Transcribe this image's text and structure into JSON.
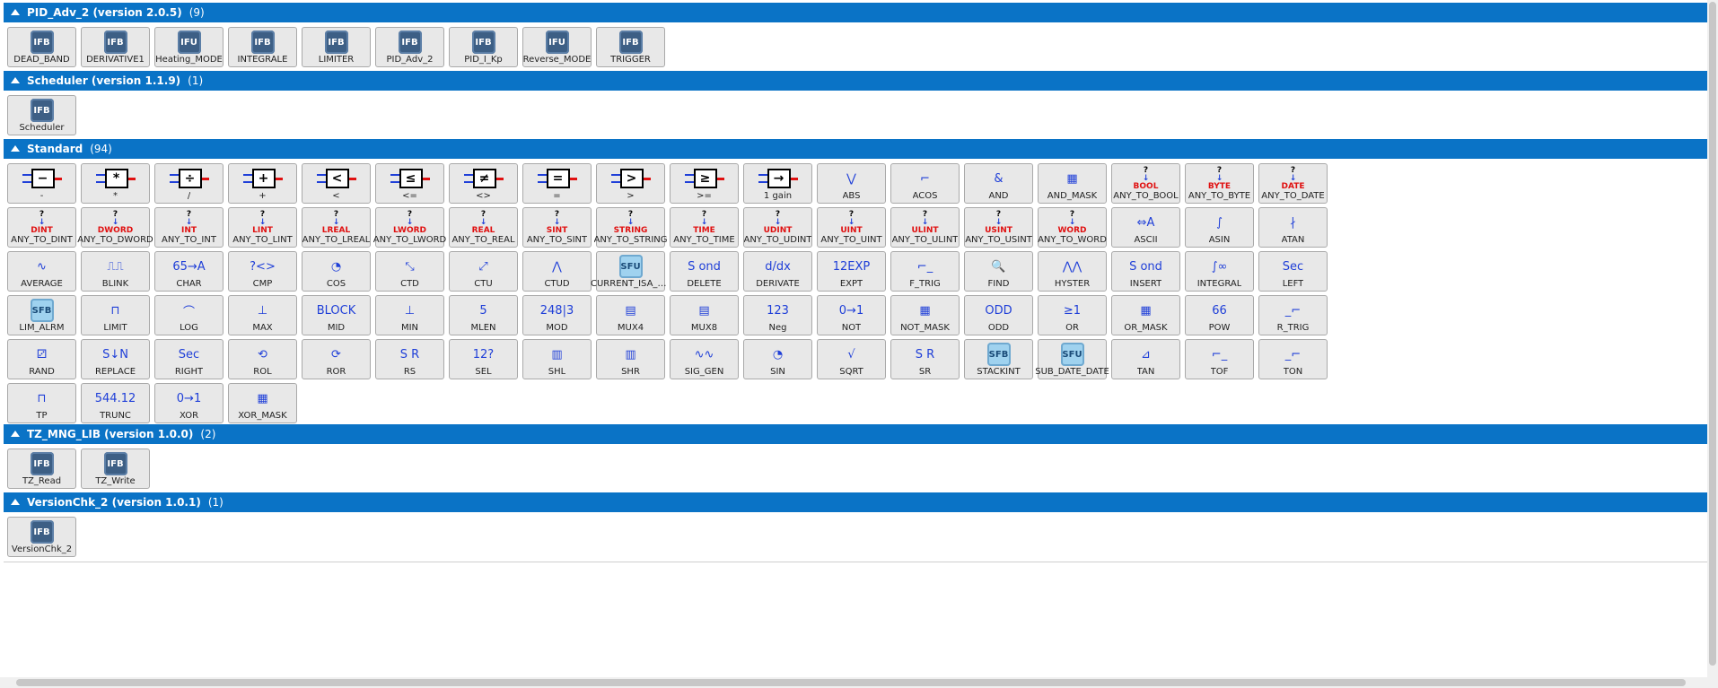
{
  "libraries": [
    {
      "name": "PID_Adv_2 (version 2.0.5)",
      "count": "(9)",
      "items": [
        {
          "label": "DEAD_BAND",
          "icon": "IFB"
        },
        {
          "label": "DERIVATIVE1",
          "icon": "IFB"
        },
        {
          "label": "Heating_MODE",
          "icon": "IFU"
        },
        {
          "label": "INTEGRALE",
          "icon": "IFB"
        },
        {
          "label": "LIMITER",
          "icon": "IFB"
        },
        {
          "label": "PID_Adv_2",
          "icon": "IFB"
        },
        {
          "label": "PID_I_Kp",
          "icon": "IFB"
        },
        {
          "label": "Reverse_MODE",
          "icon": "IFU"
        },
        {
          "label": "TRIGGER",
          "icon": "IFB"
        }
      ]
    },
    {
      "name": "Scheduler (version 1.1.9)",
      "count": "(1)",
      "items": [
        {
          "label": "Scheduler",
          "icon": "IFB"
        }
      ]
    },
    {
      "name": "Standard",
      "count": "(94)",
      "items": [
        {
          "label": "-",
          "icon": "op",
          "sym": "−"
        },
        {
          "label": "*",
          "icon": "op",
          "sym": "*"
        },
        {
          "label": "/",
          "icon": "op",
          "sym": "÷"
        },
        {
          "label": "+",
          "icon": "op",
          "sym": "+"
        },
        {
          "label": "<",
          "icon": "op",
          "sym": "<"
        },
        {
          "label": "<=",
          "icon": "op",
          "sym": "≤"
        },
        {
          "label": "<>",
          "icon": "op",
          "sym": "≠"
        },
        {
          "label": "=",
          "icon": "op",
          "sym": "="
        },
        {
          "label": ">",
          "icon": "op",
          "sym": ">"
        },
        {
          "label": ">=",
          "icon": "op",
          "sym": "≥"
        },
        {
          "label": "1 gain",
          "icon": "op",
          "sym": "→"
        },
        {
          "label": "ABS",
          "icon": "glyph",
          "sym": "⋁"
        },
        {
          "label": "ACOS",
          "icon": "glyph",
          "sym": "⌐"
        },
        {
          "label": "AND",
          "icon": "glyph",
          "sym": "&"
        },
        {
          "label": "AND_MASK",
          "icon": "glyph",
          "sym": "▦"
        },
        {
          "label": "ANY_TO_BOOL",
          "icon": "conv",
          "sym": "BOOL"
        },
        {
          "label": "ANY_TO_BYTE",
          "icon": "conv",
          "sym": "BYTE"
        },
        {
          "label": "ANY_TO_DATE",
          "icon": "conv",
          "sym": "DATE"
        },
        {
          "label": "ANY_TO_DINT",
          "icon": "conv",
          "sym": "DINT"
        },
        {
          "label": "ANY_TO_DWORD",
          "icon": "conv",
          "sym": "DWORD"
        },
        {
          "label": "ANY_TO_INT",
          "icon": "conv",
          "sym": "INT"
        },
        {
          "label": "ANY_TO_LINT",
          "icon": "conv",
          "sym": "LINT"
        },
        {
          "label": "ANY_TO_LREAL",
          "icon": "conv",
          "sym": "LREAL"
        },
        {
          "label": "ANY_TO_LWORD",
          "icon": "conv",
          "sym": "LWORD"
        },
        {
          "label": "ANY_TO_REAL",
          "icon": "conv",
          "sym": "REAL"
        },
        {
          "label": "ANY_TO_SINT",
          "icon": "conv",
          "sym": "SINT"
        },
        {
          "label": "ANY_TO_STRING",
          "icon": "conv",
          "sym": "STRING"
        },
        {
          "label": "ANY_TO_TIME",
          "icon": "conv",
          "sym": "TIME"
        },
        {
          "label": "ANY_TO_UDINT",
          "icon": "conv",
          "sym": "UDINT"
        },
        {
          "label": "ANY_TO_UINT",
          "icon": "conv",
          "sym": "UINT"
        },
        {
          "label": "ANY_TO_ULINT",
          "icon": "conv",
          "sym": "ULINT"
        },
        {
          "label": "ANY_TO_USINT",
          "icon": "conv",
          "sym": "USINT"
        },
        {
          "label": "ANY_TO_WORD",
          "icon": "conv",
          "sym": "WORD"
        },
        {
          "label": "ASCII",
          "icon": "glyph",
          "sym": "⇔A"
        },
        {
          "label": "ASIN",
          "icon": "glyph",
          "sym": "∫"
        },
        {
          "label": "ATAN",
          "icon": "glyph",
          "sym": "∤"
        },
        {
          "label": "AVERAGE",
          "icon": "glyph",
          "sym": "∿"
        },
        {
          "label": "BLINK",
          "icon": "glyph",
          "sym": "⎍⎍"
        },
        {
          "label": "CHAR",
          "icon": "glyph",
          "sym": "65→A"
        },
        {
          "label": "CMP",
          "icon": "glyph",
          "sym": "?<>"
        },
        {
          "label": "COS",
          "icon": "glyph",
          "sym": "◔"
        },
        {
          "label": "CTD",
          "icon": "glyph",
          "sym": "⤡"
        },
        {
          "label": "CTU",
          "icon": "glyph",
          "sym": "⤢"
        },
        {
          "label": "CTUD",
          "icon": "glyph",
          "sym": "⋀"
        },
        {
          "label": "CURRENT_ISA_DA...",
          "icon": "SFU"
        },
        {
          "label": "DELETE",
          "icon": "glyph",
          "sym": "S ond"
        },
        {
          "label": "DERIVATE",
          "icon": "glyph",
          "sym": "d/dx"
        },
        {
          "label": "EXPT",
          "icon": "glyph",
          "sym": "12EXP"
        },
        {
          "label": "F_TRIG",
          "icon": "glyph",
          "sym": "⌐_"
        },
        {
          "label": "FIND",
          "icon": "glyph",
          "sym": "🔍"
        },
        {
          "label": "HYSTER",
          "icon": "glyph",
          "sym": "⋀⋀"
        },
        {
          "label": "INSERT",
          "icon": "glyph",
          "sym": "S ond"
        },
        {
          "label": "INTEGRAL",
          "icon": "glyph",
          "sym": "∫∞"
        },
        {
          "label": "LEFT",
          "icon": "glyph",
          "sym": "Sec"
        },
        {
          "label": "LIM_ALRM",
          "icon": "SFB"
        },
        {
          "label": "LIMIT",
          "icon": "glyph",
          "sym": "⊓"
        },
        {
          "label": "LOG",
          "icon": "glyph",
          "sym": "⌒"
        },
        {
          "label": "MAX",
          "icon": "glyph",
          "sym": "⊥"
        },
        {
          "label": "MID",
          "icon": "glyph",
          "sym": "BLOCK"
        },
        {
          "label": "MIN",
          "icon": "glyph",
          "sym": "⊥"
        },
        {
          "label": "MLEN",
          "icon": "glyph",
          "sym": "5"
        },
        {
          "label": "MOD",
          "icon": "glyph",
          "sym": "248|3"
        },
        {
          "label": "MUX4",
          "icon": "glyph",
          "sym": "▤"
        },
        {
          "label": "MUX8",
          "icon": "glyph",
          "sym": "▤"
        },
        {
          "label": "Neg",
          "icon": "glyph",
          "sym": "123"
        },
        {
          "label": "NOT",
          "icon": "glyph",
          "sym": "0→1"
        },
        {
          "label": "NOT_MASK",
          "icon": "glyph",
          "sym": "▦"
        },
        {
          "label": "ODD",
          "icon": "glyph",
          "sym": "ODD"
        },
        {
          "label": "OR",
          "icon": "glyph",
          "sym": "≥1"
        },
        {
          "label": "OR_MASK",
          "icon": "glyph",
          "sym": "▦"
        },
        {
          "label": "POW",
          "icon": "glyph",
          "sym": "66"
        },
        {
          "label": "R_TRIG",
          "icon": "glyph",
          "sym": "_⌐"
        },
        {
          "label": "RAND",
          "icon": "glyph",
          "sym": "⚂"
        },
        {
          "label": "REPLACE",
          "icon": "glyph",
          "sym": "S↓N"
        },
        {
          "label": "RIGHT",
          "icon": "glyph",
          "sym": "Sec"
        },
        {
          "label": "ROL",
          "icon": "glyph",
          "sym": "⟲"
        },
        {
          "label": "ROR",
          "icon": "glyph",
          "sym": "⟳"
        },
        {
          "label": "RS",
          "icon": "glyph",
          "sym": "S R"
        },
        {
          "label": "SEL",
          "icon": "glyph",
          "sym": "12?"
        },
        {
          "label": "SHL",
          "icon": "glyph",
          "sym": "▥"
        },
        {
          "label": "SHR",
          "icon": "glyph",
          "sym": "▥"
        },
        {
          "label": "SIG_GEN",
          "icon": "glyph",
          "sym": "∿∿"
        },
        {
          "label": "SIN",
          "icon": "glyph",
          "sym": "◔"
        },
        {
          "label": "SQRT",
          "icon": "glyph",
          "sym": "√"
        },
        {
          "label": "SR",
          "icon": "glyph",
          "sym": "S R"
        },
        {
          "label": "STACKINT",
          "icon": "SFB"
        },
        {
          "label": "SUB_DATE_DATE",
          "icon": "SFU"
        },
        {
          "label": "TAN",
          "icon": "glyph",
          "sym": "⊿"
        },
        {
          "label": "TOF",
          "icon": "glyph",
          "sym": "⌐_"
        },
        {
          "label": "TON",
          "icon": "glyph",
          "sym": "_⌐"
        },
        {
          "label": "TP",
          "icon": "glyph",
          "sym": "⊓"
        },
        {
          "label": "TRUNC",
          "icon": "glyph",
          "sym": "544.12"
        },
        {
          "label": "XOR",
          "icon": "glyph",
          "sym": "0→1"
        },
        {
          "label": "XOR_MASK",
          "icon": "glyph",
          "sym": "▦"
        }
      ]
    },
    {
      "name": "TZ_MNG_LIB (version 1.0.0)",
      "count": "(2)",
      "items": [
        {
          "label": "TZ_Read",
          "icon": "IFB"
        },
        {
          "label": "TZ_Write",
          "icon": "IFB"
        }
      ]
    },
    {
      "name": "VersionChk_2 (version 1.0.1)",
      "count": "(1)",
      "items": [
        {
          "label": "VersionChk_2",
          "icon": "IFB"
        }
      ]
    }
  ]
}
